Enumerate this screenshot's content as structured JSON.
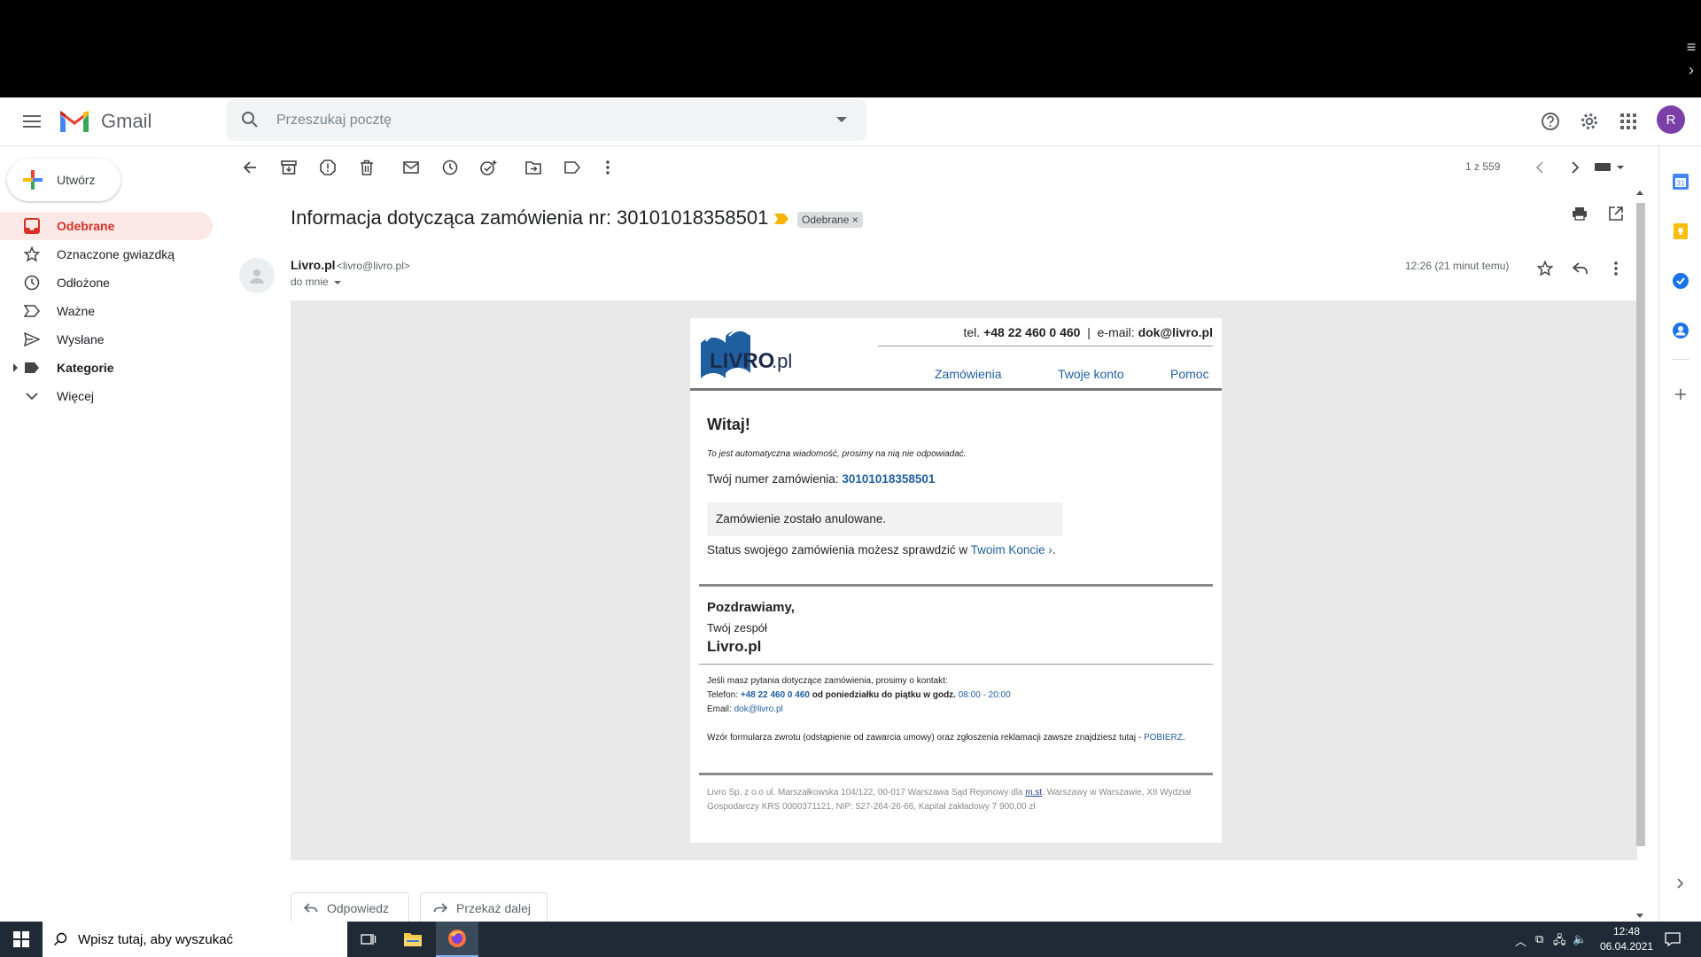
{
  "gmail": {
    "app_name": "Gmail",
    "search_placeholder": "Przeszukaj pocztę",
    "avatar_letter": "R"
  },
  "sidebar": {
    "compose_label": "Utwórz",
    "items": [
      {
        "label": "Odebrane",
        "icon": "inbox-icon",
        "active": true
      },
      {
        "label": "Oznaczone gwiazdką",
        "icon": "star-icon"
      },
      {
        "label": "Odłożone",
        "icon": "clock-icon"
      },
      {
        "label": "Ważne",
        "icon": "important-icon"
      },
      {
        "label": "Wysłane",
        "icon": "send-icon"
      },
      {
        "label": "Kategorie",
        "icon": "label-icon",
        "bold": true
      },
      {
        "label": "Więcej",
        "icon": "chevron-down-icon"
      }
    ]
  },
  "toolbar": {
    "counter": "1 z 559"
  },
  "message": {
    "subject": "Informacja dotycząca zamówienia nr: 30101018358501",
    "label_chip": "Odebrane",
    "label_chip_close": "×",
    "sender_name": "Livro.pl",
    "sender_email": "<livro@livro.pl>",
    "to_me": "do mnie",
    "time": "12:26 (21 minut temu)"
  },
  "email": {
    "logo_text": "LIVRO",
    "logo_suffix": ".pl",
    "contact_tel_prefix": "tel.",
    "contact_tel": "+48 22 460 0 460",
    "contact_sep": "|",
    "contact_email_prefix": "e-mail:",
    "contact_email": "dok@livro.pl",
    "nav": [
      "Zamówienia",
      "Twoje konto",
      "Pomoc"
    ],
    "greeting": "Witaj!",
    "auto_note": "To jest automatyczna wiadomość, prosimy na nią nie odpowiadać.",
    "order_prefix": "Twój numer zamówienia:",
    "order_number": "30101018358501",
    "cancel_text": "Zamówienie zostało anulowane.",
    "status_prefix": "Status swojego zamówienia możesz sprawdzić w",
    "status_link": "Twoim Koncie ›",
    "status_suffix": ".",
    "regards": "Pozdrawiamy,",
    "team": "Twój zespół",
    "brand": "Livro.pl",
    "questions": "Jeśli masz pytania dotyczące zamówienia, prosimy o kontakt:",
    "phone_prefix": "Telefon:",
    "phone": "+48 22 460 0 460",
    "phone_hours_label": "od poniedziałku do piątku w godz.",
    "phone_hours": "08:00 - 20:00",
    "email_prefix": "Email:",
    "email": "dok@livro.pl",
    "return_text": "Wzór formularza zwrotu (odstąpienie od zawarcia umowy) oraz zgłoszenia reklamacji zawsze znajdziesz tutaj -",
    "return_link": "POBIERZ",
    "return_suffix": ".",
    "legal_1": "Livro Sp. z o.o ul. Marszałkowska 104/122, 00-017 Warszawa Sąd Rejonowy dla",
    "legal_link": "m.st",
    "legal_2": ". Warszawy w Warszawie, XII Wydział Gospodarczy KRS 0000371121, NIP: 527-264-26-66, Kapitał zakładowy 7 900,00 zł"
  },
  "actions": {
    "reply": "Odpowiedz",
    "forward": "Przekaż dalej"
  },
  "taskbar": {
    "search_placeholder": "Wpisz tutaj, aby wyszukać",
    "time": "12:48",
    "date": "06.04.2021"
  },
  "colors": {
    "gmail_red": "#d93025",
    "livro_blue": "#1f5fa0",
    "avatar_purple": "#7b3fa8"
  }
}
